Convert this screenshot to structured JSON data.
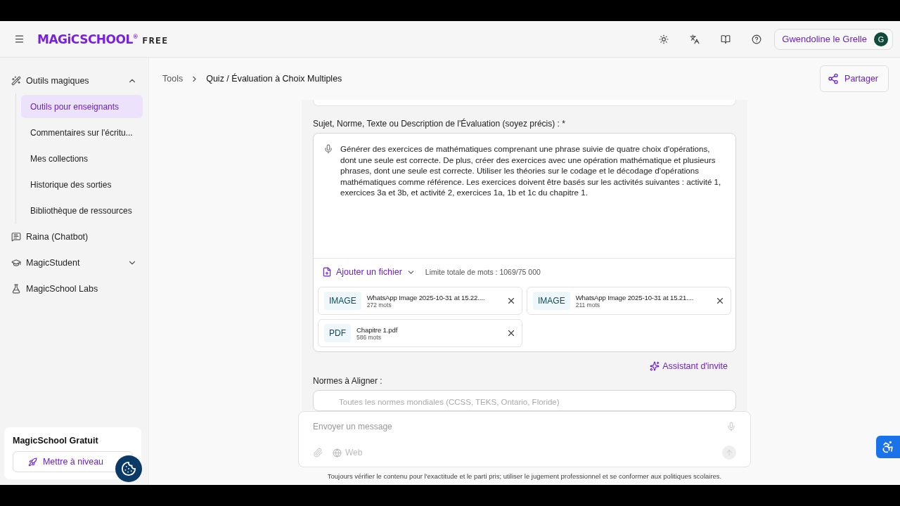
{
  "header": {
    "logo": "MAGiCSCHOOL$^{®}$",
    "plan": "FREE",
    "user": {
      "name": "Gwendoline le Grelle",
      "initial": "G"
    }
  },
  "sidebar": {
    "items": [
      {
        "label": "Outils magiques",
        "kind": "group",
        "expanded": true,
        "children": [
          {
            "label": "Outils pour enseignants",
            "selected": true
          },
          {
            "label": "Commentaires sur l'écritu...",
            "selected": false
          },
          {
            "label": "Mes collections",
            "selected": false
          },
          {
            "label": "Historique des sorties",
            "selected": false
          },
          {
            "label": "Bibliothèque de ressources",
            "selected": false
          }
        ]
      },
      {
        "label": "Raina (Chatbot)",
        "kind": "link"
      },
      {
        "label": "MagicStudent",
        "kind": "group",
        "expanded": false
      },
      {
        "label": "MagicSchool Labs",
        "kind": "link"
      }
    ],
    "upgrade": {
      "title": "MagicSchool Gratuit",
      "button": "Mettre à niveau"
    }
  },
  "breadcrumb": [
    "Tools",
    "Quiz / Évaluation à Choix Multiples"
  ],
  "share_button": "Partager",
  "form": {
    "subject": {
      "label": "Sujet, Norme, Texte ou Description de l'Évaluation (soyez précis) : *",
      "value": "Générer des exercices de mathématiques comprenant une phrase suivie de quatre choix d'opérations, dont une seule est correcte. De plus, créer des exercices avec une opération mathématique et plusieurs phrases, dont une seule est correcte. Utiliser les théories sur le codage et le décodage d'opérations mathématiques comme référence. Les exercices doivent être basés sur les activités suivantes : activité 1, exercices 3a et 3b, et activité 2, exercices 1a, 1b et 1c du chapitre 1.",
      "add_file": "Ajouter un fichier",
      "word_limit": "Limite totale de mots : 1069/75 000",
      "attachments": [
        {
          "type": "IMAGE",
          "name": "WhatsApp Image 2025-10-31 at 15.22....",
          "words": "272 mots"
        },
        {
          "type": "IMAGE",
          "name": "WhatsApp Image 2025-10-31 at 15.21....",
          "words": "211 mots"
        },
        {
          "type": "PDF",
          "name": "Chapitre 1.pdf",
          "words": "586 mots"
        }
      ]
    },
    "assistant": "Assistant d'invite",
    "standards": {
      "label": "Normes à Aligner :",
      "placeholder": "Toutes les normes mondiales (CCSS, TEKS, Ontario, Floride)"
    }
  },
  "chat": {
    "placeholder": "Envoyer un message",
    "web": "Web",
    "disclaimer": "Toujours vérifier le contenu pour l'exactitude et le parti pris; utiliser le jugement professionnel et se conformer aux politiques scolaires."
  }
}
